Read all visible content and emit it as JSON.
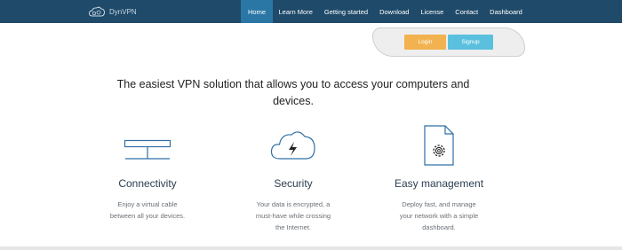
{
  "brand": {
    "name": "DynVPN",
    "logo_icon": "cloud-logo-icon"
  },
  "nav": {
    "items": [
      {
        "label": "Home",
        "active": true
      },
      {
        "label": "Learn More",
        "active": false
      },
      {
        "label": "Getting started",
        "active": false
      },
      {
        "label": "Download",
        "active": false
      },
      {
        "label": "License",
        "active": false
      },
      {
        "label": "Contact",
        "active": false
      },
      {
        "label": "Dashboard",
        "active": false
      }
    ]
  },
  "auth": {
    "login_label": "Login",
    "signup_label": "Signup"
  },
  "hero": {
    "headline": "The easiest VPN solution that allows you to access your computers and devices."
  },
  "features": [
    {
      "icon": "network-icon",
      "title": "Connectivity",
      "line1": "Enjoy a virtual cable",
      "line2": "between all your devices."
    },
    {
      "icon": "cloud-bolt-icon",
      "title": "Security",
      "line1": "Your data is encrypted, a",
      "line2": "must-have while crossing",
      "line3": "the Internet."
    },
    {
      "icon": "document-gear-icon",
      "title": "Easy management",
      "line1": "Deploy fast, and manage",
      "line2": "your network with a simple",
      "line3": "dashboard."
    }
  ],
  "colors": {
    "navbar": "#1f4a6a",
    "nav_active": "#2a77a6",
    "login": "#f2b250",
    "signup": "#5bc0de",
    "icon_blue": "#2f6fa6"
  }
}
